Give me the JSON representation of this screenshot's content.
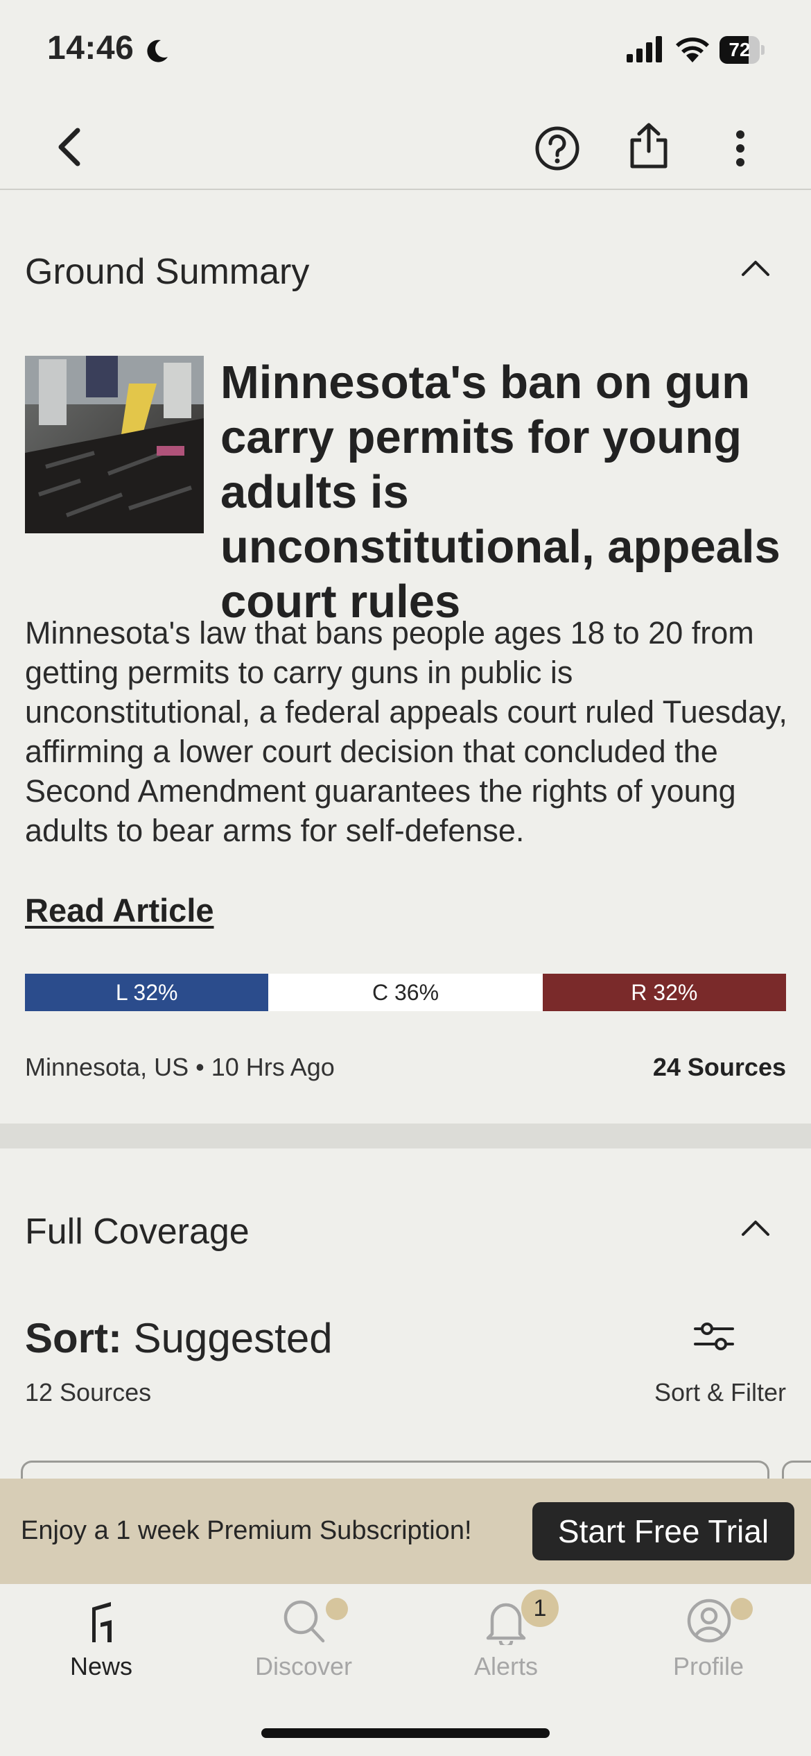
{
  "status_bar": {
    "time": "14:46",
    "battery": "72",
    "battery_level": 0.72
  },
  "toolbar": {
    "back_icon": "chevron-left-icon",
    "help_icon": "question-circle-icon",
    "share_icon": "share-icon",
    "more_icon": "more-vertical-icon"
  },
  "ground_summary": {
    "title": "Ground Summary",
    "headline": "Minnesota's ban on gun carry permits for young adults is unconstitutional, appeals court rules",
    "summary": "Minnesota's law that bans people ages 18 to 20 from getting permits to carry guns in public is unconstitutional, a federal appeals court ruled Tuesday, affirming a lower court decision that concluded the Second Amendment guarantees the rights of young adults to bear arms for self-defense.",
    "read_article": "Read Article",
    "bias": [
      {
        "label": "L 32%",
        "share": 32,
        "color": "#2b4c8c",
        "text_color": "#ffffff"
      },
      {
        "label": "C 36%",
        "share": 36,
        "color": "#ffffff",
        "text_color": "#262626"
      },
      {
        "label": "R 32%",
        "share": 32,
        "color": "#7a2a2a",
        "text_color": "#ffffff"
      }
    ],
    "location_time": "Minnesota, US • 10 Hrs Ago",
    "sources": "24 Sources"
  },
  "full_coverage": {
    "title": "Full Coverage",
    "sort_prefix": "Sort:",
    "sort_value": "Suggested",
    "sources_count": "12 Sources",
    "filter_label": "Sort & Filter"
  },
  "promo": {
    "text": "Enjoy a 1 week Premium Subscription!",
    "button": "Start Free Trial"
  },
  "tabs": [
    {
      "label": "News",
      "icon": "ground-logo-icon",
      "active": true
    },
    {
      "label": "Discover",
      "icon": "search-icon",
      "active": false
    },
    {
      "label": "Alerts",
      "icon": "bell-icon",
      "active": false,
      "badge": "1"
    },
    {
      "label": "Profile",
      "icon": "user-circle-icon",
      "active": false
    }
  ],
  "colors": {
    "background": "#efefeb",
    "accent": "#d6c59d",
    "promo_bg": "#d7cdb6",
    "inactive_tab": "#a6a6a6"
  }
}
